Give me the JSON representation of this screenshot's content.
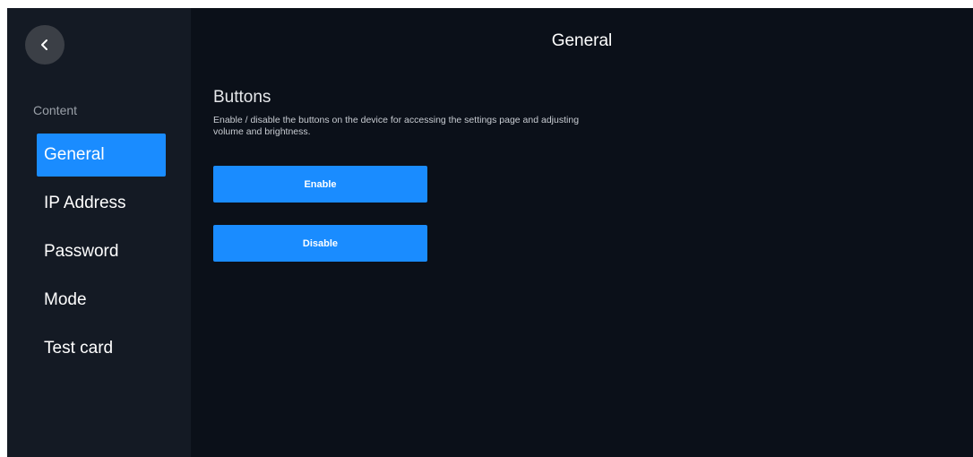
{
  "header": {
    "title": "General",
    "back_icon": "chevron-left-icon"
  },
  "sidebar": {
    "section_label": "Content",
    "items": [
      {
        "label": "General",
        "active": true
      },
      {
        "label": "IP Address",
        "active": false
      },
      {
        "label": "Password",
        "active": false
      },
      {
        "label": "Mode",
        "active": false
      },
      {
        "label": "Test card",
        "active": false
      }
    ]
  },
  "main": {
    "section_title": "Buttons",
    "section_description": "Enable / disable the buttons on the device for accessing the settings page and adjusting volume and brightness.",
    "enable_label": "Enable",
    "disable_label": "Disable"
  },
  "colors": {
    "background": "#0b1019",
    "sidebar": "#141a24",
    "accent": "#1a8cff",
    "back_button": "#3b3f46"
  }
}
